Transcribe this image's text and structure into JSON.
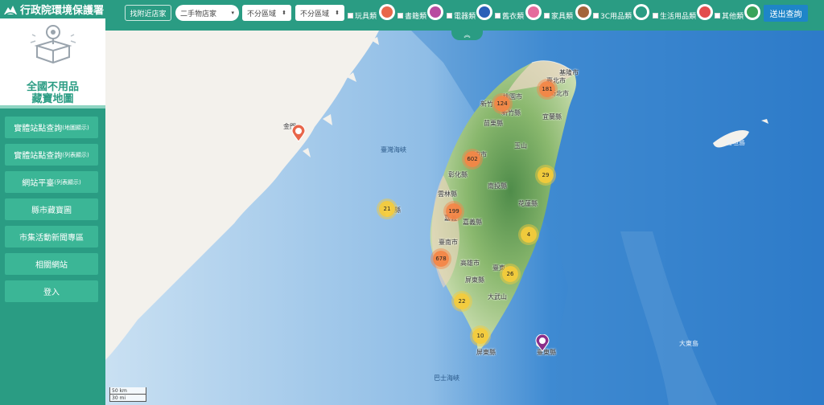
{
  "brand": {
    "title": "行政院環境保護署"
  },
  "hero": {
    "line1": "全國不用品",
    "line2": "藏寶地圖"
  },
  "nav": [
    {
      "label": "實體站點查詢",
      "sub": "(地圖顯示)"
    },
    {
      "label": "實體站點查詢",
      "sub": "(列表顯示)"
    },
    {
      "label": "網站平臺",
      "sub": "(列表顯示)"
    },
    {
      "label": "縣市藏寶圖",
      "sub": ""
    },
    {
      "label": "市集活動新聞專區",
      "sub": ""
    },
    {
      "label": "相關網站",
      "sub": ""
    },
    {
      "label": "登入",
      "sub": ""
    }
  ],
  "toolbar": {
    "near_label": "找附近店家",
    "type_select": "二手物店家",
    "region_a": "不分區域",
    "region_b": "不分區域",
    "categories": [
      {
        "label": "玩具類",
        "icon": "toy-icon",
        "color": "#e8664a"
      },
      {
        "label": "書籍類",
        "icon": "book-icon",
        "color": "#b84ba0"
      },
      {
        "label": "電器類",
        "icon": "appliance-icon",
        "color": "#2a5fb8"
      },
      {
        "label": "舊衣類",
        "icon": "clothes-icon",
        "color": "#e56b9c"
      },
      {
        "label": "家具類",
        "icon": "furniture-icon",
        "color": "#a3643a"
      },
      {
        "label": "3C用品類",
        "icon": "device-icon",
        "color": "#2a9c83"
      },
      {
        "label": "生活用品類",
        "icon": "household-icon",
        "color": "#e24d4d"
      },
      {
        "label": "其他類",
        "icon": "other-icon",
        "color": "#3aa35a"
      }
    ],
    "send_label": "送出查詢"
  },
  "map": {
    "labels": {
      "keelung": "基隆市",
      "taipei": "臺北市",
      "newtaipei": "新北市",
      "taoyuan": "桃園市",
      "hsinchu_city": "新竹",
      "hsinchu": "新竹縣",
      "yilan": "宜蘭縣",
      "miaoli": "苗栗縣",
      "taichung": "中市",
      "changhua": "彰化縣",
      "nantou": "南投縣",
      "hualien": "花蓮縣",
      "yunlin": "雲林縣",
      "chiayi_city": "嘉義",
      "chiayi": "嘉義縣",
      "tainan": "臺南市",
      "kaohsiung": "高雄市",
      "taitung": "臺東",
      "pingtung": "屏東縣",
      "pingtung2": "屏東縣",
      "penghu": "縣",
      "kinmen": "金門",
      "strait": "臺灣海峽",
      "bashi": "巴士海峽",
      "yonaguni": "石垣島",
      "kitadaito": "大東島",
      "lanyu": "臺東縣",
      "mountain1": "玉山",
      "mountain2": "大武山"
    },
    "clusters": [
      {
        "label": "181",
        "color": "orange"
      },
      {
        "label": "124",
        "color": "orange"
      },
      {
        "label": "602",
        "color": "orange"
      },
      {
        "label": "29",
        "color": "yellow"
      },
      {
        "label": "21",
        "color": "yellow"
      },
      {
        "label": "199",
        "color": "orange"
      },
      {
        "label": "4",
        "color": "yellow"
      },
      {
        "label": "678",
        "color": "orange"
      },
      {
        "label": "26",
        "color": "yellow"
      },
      {
        "label": "22",
        "color": "yellow"
      },
      {
        "label": "10",
        "color": "yellow"
      }
    ],
    "scale": {
      "km": "50 km",
      "mi": "30 mi"
    }
  }
}
